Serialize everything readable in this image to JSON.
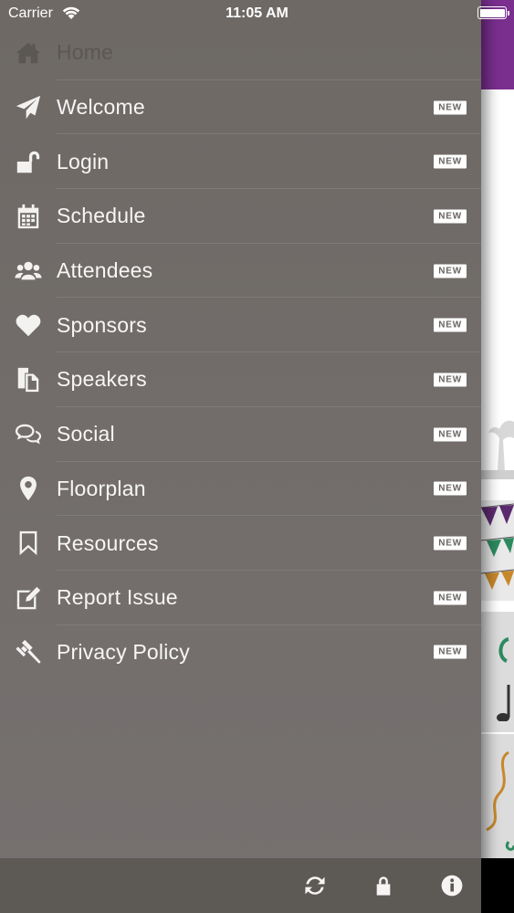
{
  "status_bar": {
    "carrier": "Carrier",
    "time": "11:05 AM"
  },
  "menu": {
    "items": [
      {
        "label": "Home",
        "icon": "home-icon",
        "active": true,
        "badge": ""
      },
      {
        "label": "Welcome",
        "icon": "paper-plane-icon",
        "badge": "NEW"
      },
      {
        "label": "Login",
        "icon": "unlock-icon",
        "badge": "NEW"
      },
      {
        "label": "Schedule",
        "icon": "calendar-icon",
        "badge": "NEW"
      },
      {
        "label": "Attendees",
        "icon": "users-icon",
        "badge": "NEW"
      },
      {
        "label": "Sponsors",
        "icon": "heart-icon",
        "badge": "NEW"
      },
      {
        "label": "Speakers",
        "icon": "files-icon",
        "badge": "NEW"
      },
      {
        "label": "Social",
        "icon": "chat-bubbles-icon",
        "badge": "NEW"
      },
      {
        "label": "Floorplan",
        "icon": "map-pin-icon",
        "badge": "NEW"
      },
      {
        "label": "Resources",
        "icon": "bookmark-icon",
        "badge": "NEW"
      },
      {
        "label": "Report Issue",
        "icon": "edit-icon",
        "badge": "NEW"
      },
      {
        "label": "Privacy Policy",
        "icon": "gavel-icon",
        "badge": "NEW"
      }
    ]
  },
  "toolbar": {
    "buttons": [
      "refresh-icon",
      "lock-icon",
      "info-icon"
    ]
  },
  "colors": {
    "drawer_bg": "#6f6a66",
    "toolbar_bg": "#5d5955",
    "accent_purple": "#7a2f8f",
    "badge_bg": "#ffffff"
  }
}
